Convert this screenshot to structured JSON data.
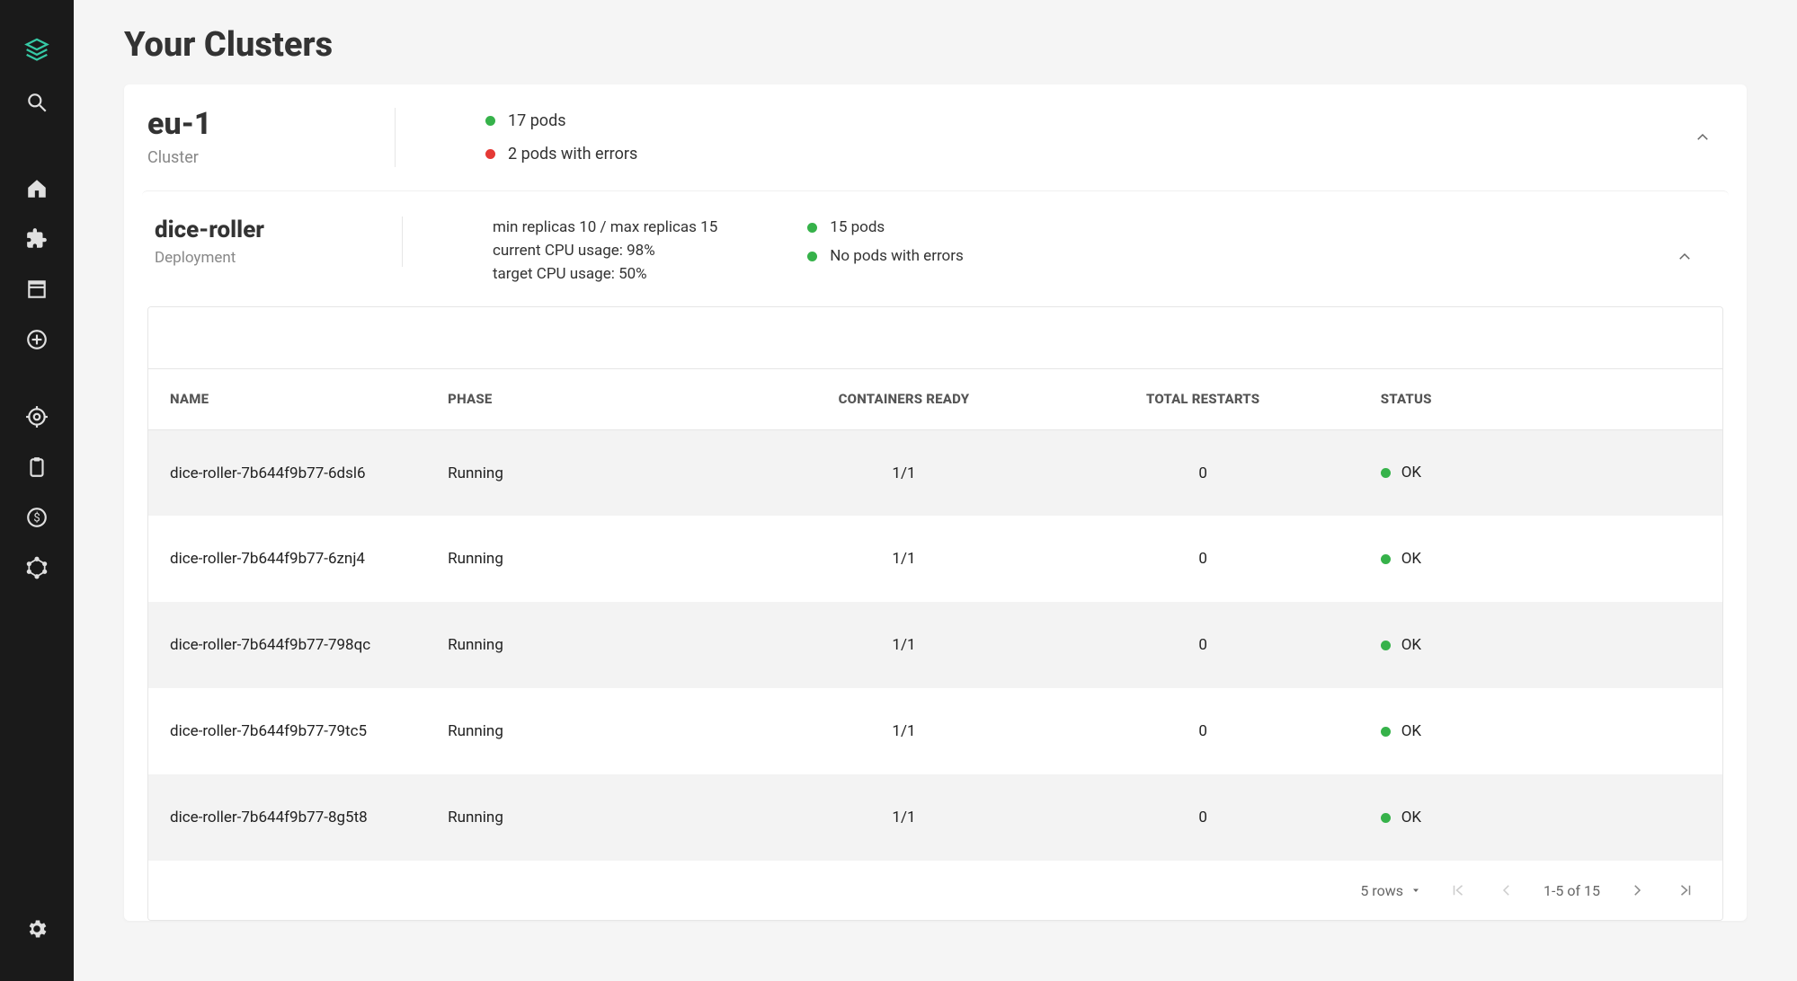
{
  "sidebar": {
    "items": [
      {
        "name": "logo-icon"
      },
      {
        "name": "search-icon"
      },
      {
        "name": "home-icon"
      },
      {
        "name": "extension-icon"
      },
      {
        "name": "library-icon"
      },
      {
        "name": "add-circle-icon"
      },
      {
        "name": "target-icon"
      },
      {
        "name": "clipboard-icon"
      },
      {
        "name": "money-icon"
      },
      {
        "name": "graphql-icon"
      },
      {
        "name": "settings-icon"
      }
    ]
  },
  "page": {
    "title": "Your Clusters"
  },
  "cluster": {
    "name": "eu-1",
    "type_label": "Cluster",
    "pods_line": "17 pods",
    "error_line": "2 pods with errors"
  },
  "deployment": {
    "name": "dice-roller",
    "type_label": "Deployment",
    "replicas_line": "min replicas 10 / max replicas 15",
    "current_cpu_line": "current CPU usage: 98%",
    "target_cpu_line": "target CPU usage: 50%",
    "pods_line": "15 pods",
    "error_line": "No pods with errors"
  },
  "table": {
    "headers": {
      "name": "NAME",
      "phase": "PHASE",
      "ready": "CONTAINERS READY",
      "restarts": "TOTAL RESTARTS",
      "status": "STATUS"
    },
    "rows": [
      {
        "name": "dice-roller-7b644f9b77-6dsl6",
        "phase": "Running",
        "ready": "1/1",
        "restarts": "0",
        "status": "OK"
      },
      {
        "name": "dice-roller-7b644f9b77-6znj4",
        "phase": "Running",
        "ready": "1/1",
        "restarts": "0",
        "status": "OK"
      },
      {
        "name": "dice-roller-7b644f9b77-798qc",
        "phase": "Running",
        "ready": "1/1",
        "restarts": "0",
        "status": "OK"
      },
      {
        "name": "dice-roller-7b644f9b77-79tc5",
        "phase": "Running",
        "ready": "1/1",
        "restarts": "0",
        "status": "OK"
      },
      {
        "name": "dice-roller-7b644f9b77-8g5t8",
        "phase": "Running",
        "ready": "1/1",
        "restarts": "0",
        "status": "OK"
      }
    ]
  },
  "pagination": {
    "rows_label": "5 rows",
    "range_label": "1-5 of 15"
  }
}
